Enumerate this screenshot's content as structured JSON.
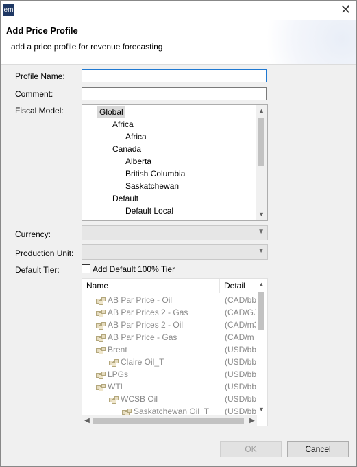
{
  "app": {
    "icon_text": "em"
  },
  "header": {
    "title": "Add Price Profile",
    "subtitle": "add a price profile for revenue forecasting"
  },
  "form": {
    "profile_name_label": "Profile Name:",
    "profile_name_value": "",
    "comment_label": "Comment:",
    "comment_value": "",
    "fiscal_model_label": "Fiscal Model:",
    "currency_label": "Currency:",
    "currency_value": "",
    "production_unit_label": "Production Unit:",
    "production_unit_value": "",
    "default_tier_label": "Default Tier:",
    "default_tier_checkbox_label": "Add Default 100% Tier",
    "default_tier_checked": false
  },
  "fiscal_tree": {
    "items": [
      {
        "label": "Global",
        "level": 0,
        "selected": true
      },
      {
        "label": "Africa",
        "level": 1
      },
      {
        "label": "Africa",
        "level": 2
      },
      {
        "label": "Canada",
        "level": 1
      },
      {
        "label": "Alberta",
        "level": 2
      },
      {
        "label": "British Columbia",
        "level": 2
      },
      {
        "label": "Saskatchewan",
        "level": 2
      },
      {
        "label": "Default",
        "level": 1
      },
      {
        "label": "Default Local",
        "level": 2
      }
    ]
  },
  "price_table": {
    "columns": [
      "Name",
      "Detail"
    ],
    "rows": [
      {
        "name": "AB Par Price - Oil",
        "detail": "(CAD/bb",
        "level": 0
      },
      {
        "name": "AB Par Prices 2 - Gas",
        "detail": "(CAD/GJ",
        "level": 0
      },
      {
        "name": "AB Par Prices 2 - Oil",
        "detail": "(CAD/m3",
        "level": 0
      },
      {
        "name": "AB Par Price - Gas",
        "detail": "(CAD/m",
        "level": 0
      },
      {
        "name": "Brent",
        "detail": "(USD/bb",
        "level": 0
      },
      {
        "name": "Claire Oil_T",
        "detail": "(USD/bb",
        "level": 1
      },
      {
        "name": "LPGs",
        "detail": "(USD/bb",
        "level": 0
      },
      {
        "name": "WTI",
        "detail": "(USD/bb",
        "level": 0
      },
      {
        "name": "WCSB Oil",
        "detail": "(USD/bb",
        "level": 1
      },
      {
        "name": "Saskatchewan Oil_T",
        "detail": "(USD/bb",
        "level": 2
      }
    ]
  },
  "buttons": {
    "ok": "OK",
    "cancel": "Cancel"
  },
  "icons": {
    "app": "app-icon",
    "close": "close-icon",
    "dropdown": "chevron-down-icon",
    "price_row": "price-folder-icon"
  },
  "colors": {
    "focus_border": "#1f78d1",
    "app_icon_bg": "#1f3864",
    "disabled_text": "#8a8a8a"
  }
}
